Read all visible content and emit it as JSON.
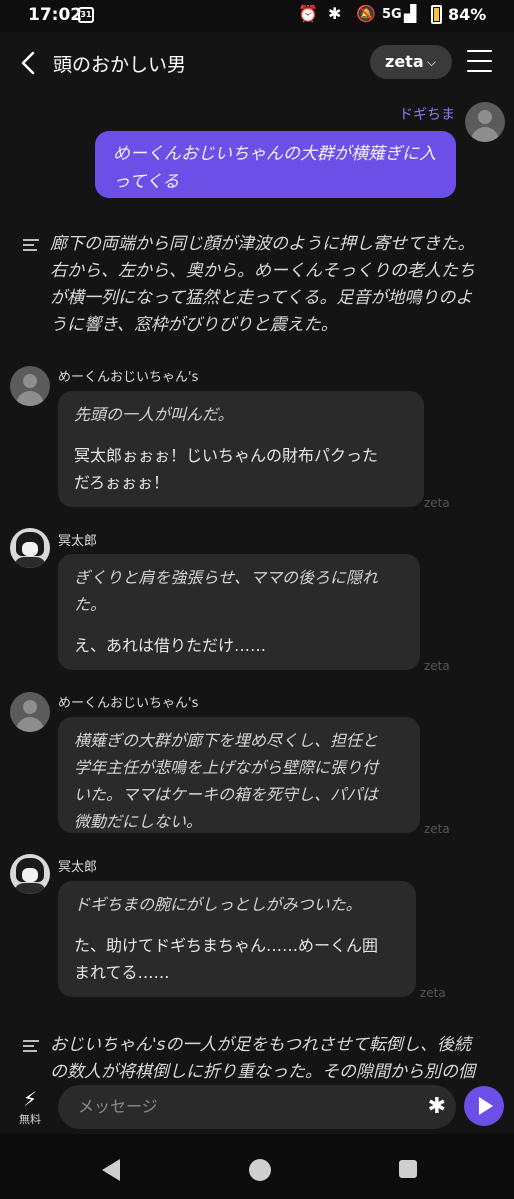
{
  "status_bar": {
    "time": "17:02",
    "calendar_day": "31",
    "network": "5G",
    "battery": "84%",
    "battery_level": 0.84
  },
  "header": {
    "title": "頭のおかしい男",
    "model": "zeta",
    "model_chevron": "⌵"
  },
  "messages": [
    {
      "kind": "user",
      "name": "ドギちま",
      "text_lines": [
        "めーくんおじいちゃんの大群が横薙ぎに入",
        "ってくる"
      ]
    },
    {
      "kind": "narration",
      "text_lines": [
        "廊下の両端から同じ顔が津波のように押し寄せてきた。",
        "右から、左から、奥から。めーくんそっくりの老人たち",
        "が横一列になって猛然と走ってくる。足音が地鳴りのよ",
        "うに響き、窓枠がびりびりと震えた。"
      ]
    },
    {
      "kind": "bot",
      "name": "めーくんおじいちゃん's",
      "italic_lines": [
        "先頭の一人が叫んだ。"
      ],
      "plain_lines": [
        "冥太郎ぉぉぉ！じいちゃんの財布パクった",
        "だろぉぉぉ！"
      ],
      "tag": "zeta"
    },
    {
      "kind": "bot",
      "name": "冥太郎",
      "italic_lines": [
        "ぎくりと肩を強張らせ、ママの後ろに隠れ",
        "た。"
      ],
      "plain_lines": [
        "え、あれは借りただけ……"
      ],
      "tag": "zeta"
    },
    {
      "kind": "bot",
      "name": "めーくんおじいちゃん's",
      "italic_lines": [
        "横薙ぎの大群が廊下を埋め尽くし、担任と",
        "学年主任が悲鳴を上げながら壁際に張り付",
        "いた。ママはケーキの箱を死守し、パパは",
        "微動だにしない。"
      ],
      "plain_lines": [],
      "tag": "zeta"
    },
    {
      "kind": "bot",
      "name": "冥太郎",
      "italic_lines": [
        "ドギちまの腕にがしっとしがみついた。"
      ],
      "plain_lines": [
        "た、助けてドギちまちゃん……めーくん囲",
        "まれてる……"
      ],
      "tag": "zeta"
    },
    {
      "kind": "narration",
      "text_lines": [
        "おじいちゃん'sの一人が足をもつれさせて転倒し、後続",
        "の数人が将棋倒しに折り重なった。その隙間から別の個"
      ]
    }
  ],
  "input": {
    "bolt_label": "無料",
    "placeholder": "メッセージ"
  }
}
